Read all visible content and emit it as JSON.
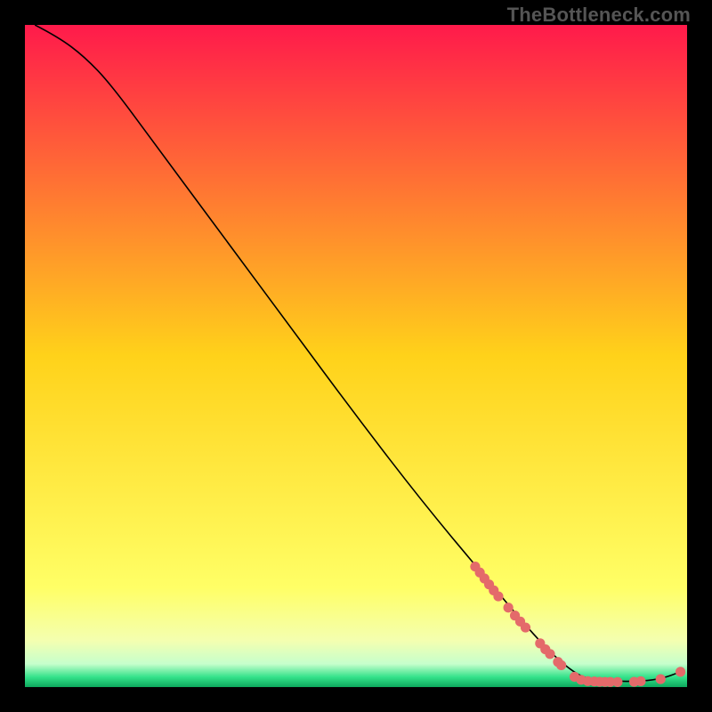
{
  "watermark": "TheBottleneck.com",
  "chart_data": {
    "type": "line",
    "title": "",
    "xlabel": "",
    "ylabel": "",
    "xlim": [
      0,
      100
    ],
    "ylim": [
      0,
      100
    ],
    "background_gradient": {
      "stops": [
        {
          "offset": 0.0,
          "color": "#ff1a4b"
        },
        {
          "offset": 0.5,
          "color": "#ffd21a"
        },
        {
          "offset": 0.85,
          "color": "#ffff66"
        },
        {
          "offset": 0.93,
          "color": "#f4ffb0"
        },
        {
          "offset": 0.965,
          "color": "#c6ffcc"
        },
        {
          "offset": 0.985,
          "color": "#33e28a"
        },
        {
          "offset": 1.0,
          "color": "#0da85d"
        }
      ]
    },
    "series": [
      {
        "name": "bottleneck-curve",
        "type": "line",
        "color": "#000000",
        "width": 1.6,
        "points": [
          {
            "x": 1.5,
            "y": 100.0
          },
          {
            "x": 5.0,
            "y": 98.2
          },
          {
            "x": 9.0,
            "y": 95.2
          },
          {
            "x": 13.0,
            "y": 91.0
          },
          {
            "x": 20.0,
            "y": 81.5
          },
          {
            "x": 30.0,
            "y": 68.0
          },
          {
            "x": 40.0,
            "y": 54.5
          },
          {
            "x": 50.0,
            "y": 41.0
          },
          {
            "x": 60.0,
            "y": 28.0
          },
          {
            "x": 70.0,
            "y": 16.0
          },
          {
            "x": 78.0,
            "y": 6.5
          },
          {
            "x": 83.0,
            "y": 2.0
          },
          {
            "x": 86.0,
            "y": 1.0
          },
          {
            "x": 92.0,
            "y": 0.8
          },
          {
            "x": 96.0,
            "y": 1.2
          },
          {
            "x": 99.0,
            "y": 2.3
          }
        ]
      },
      {
        "name": "data-markers",
        "type": "scatter",
        "color": "#e46a6a",
        "radius": 5.6,
        "points": [
          {
            "x": 68.0,
            "y": 18.2
          },
          {
            "x": 68.7,
            "y": 17.3
          },
          {
            "x": 69.4,
            "y": 16.4
          },
          {
            "x": 70.1,
            "y": 15.5
          },
          {
            "x": 70.8,
            "y": 14.6
          },
          {
            "x": 71.5,
            "y": 13.7
          },
          {
            "x": 73.0,
            "y": 12.0
          },
          {
            "x": 74.0,
            "y": 10.8
          },
          {
            "x": 74.8,
            "y": 9.9
          },
          {
            "x": 75.6,
            "y": 9.0
          },
          {
            "x": 77.8,
            "y": 6.6
          },
          {
            "x": 78.6,
            "y": 5.7
          },
          {
            "x": 79.3,
            "y": 5.0
          },
          {
            "x": 80.5,
            "y": 3.8
          },
          {
            "x": 81.0,
            "y": 3.3
          },
          {
            "x": 83.0,
            "y": 1.55
          },
          {
            "x": 84.0,
            "y": 1.1
          },
          {
            "x": 85.0,
            "y": 0.9
          },
          {
            "x": 86.0,
            "y": 0.85
          },
          {
            "x": 86.8,
            "y": 0.8
          },
          {
            "x": 87.6,
            "y": 0.78
          },
          {
            "x": 88.4,
            "y": 0.77
          },
          {
            "x": 89.5,
            "y": 0.76
          },
          {
            "x": 92.0,
            "y": 0.8
          },
          {
            "x": 93.0,
            "y": 0.88
          },
          {
            "x": 96.0,
            "y": 1.2
          },
          {
            "x": 99.0,
            "y": 2.3
          }
        ]
      }
    ]
  }
}
